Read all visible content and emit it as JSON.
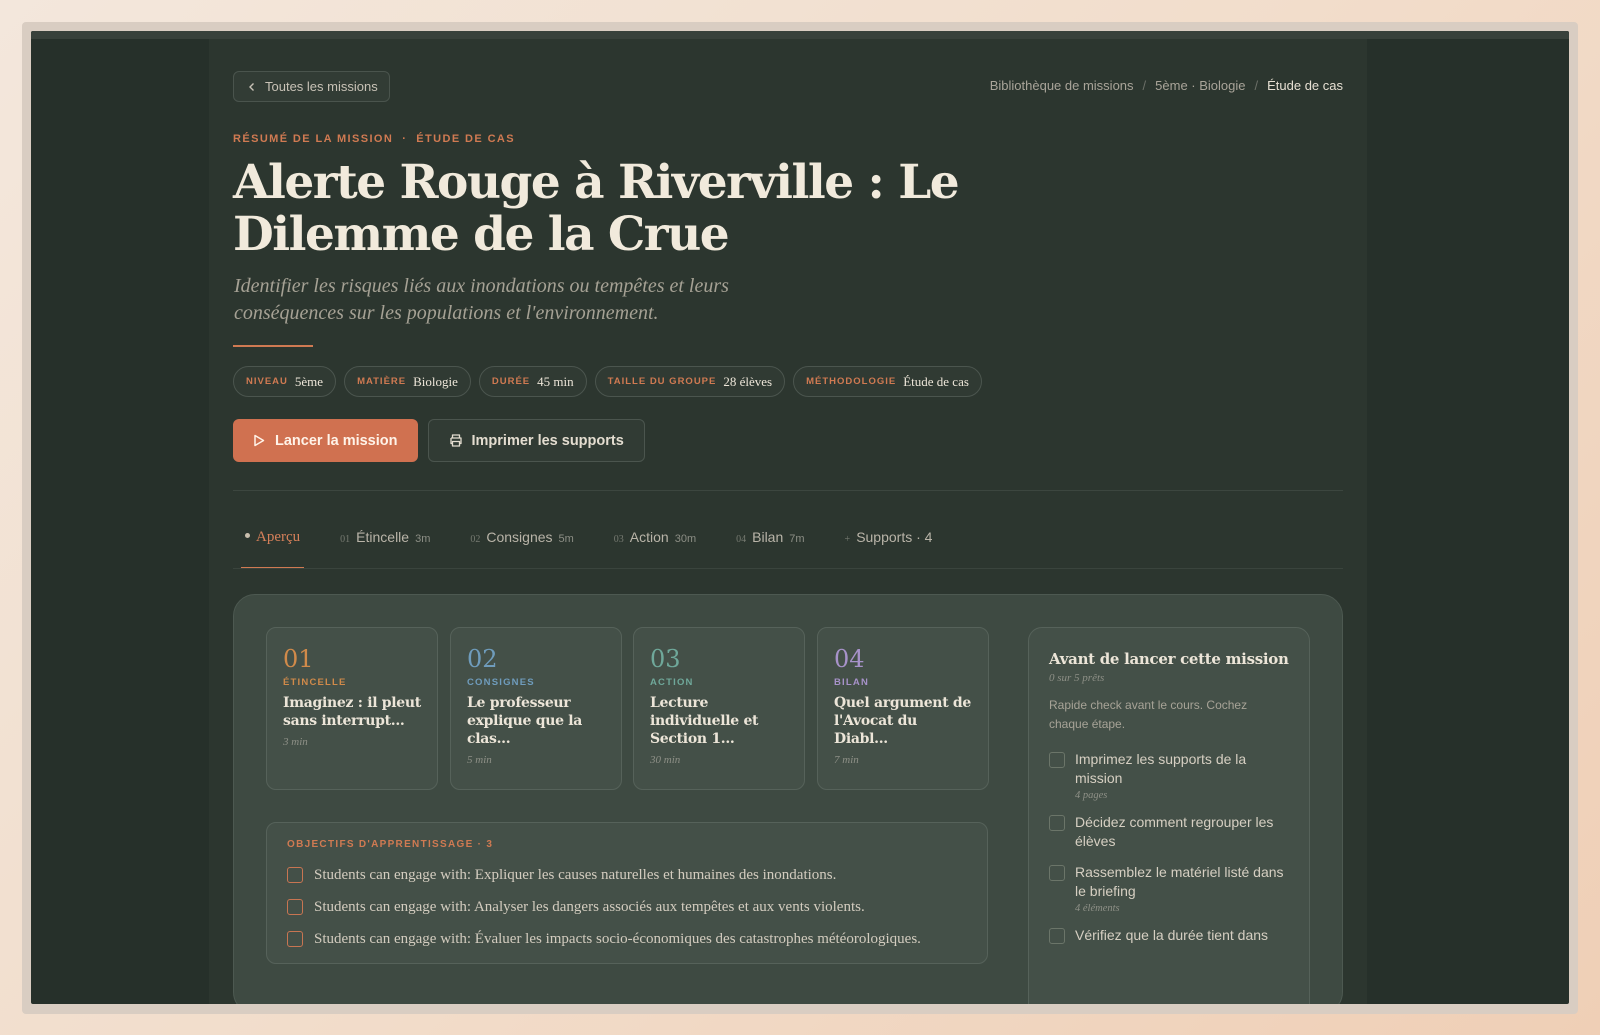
{
  "header": {
    "back_label": "Toutes les missions",
    "breadcrumb": [
      "Bibliothèque de missions",
      "5ème · Biologie",
      "Étude de cas"
    ]
  },
  "mission": {
    "eyebrow": [
      "RÉSUMÉ DE LA MISSION",
      "·",
      "ÉTUDE DE CAS"
    ],
    "title": "Alerte Rouge à Riverville : Le Dilemme de la Crue",
    "subtitle": "Identifier les risques liés aux inondations ou tempêtes et leurs conséquences sur les populations et l'environnement.",
    "meta": [
      {
        "key": "NIVEAU",
        "value": "5ème"
      },
      {
        "key": "MATIÈRE",
        "value": "Biologie"
      },
      {
        "key": "DURÉE",
        "value": "45 min"
      },
      {
        "key": "TAILLE DU GROUPE",
        "value": "28 élèves"
      },
      {
        "key": "MÉTHODOLOGIE",
        "value": "Étude de cas"
      }
    ],
    "launch_label": "Lancer la mission",
    "print_label": "Imprimer les supports"
  },
  "tabs": [
    {
      "num": "",
      "label": "Aperçu",
      "dur": ""
    },
    {
      "num": "01",
      "label": "Étincelle",
      "dur": "3m"
    },
    {
      "num": "02",
      "label": "Consignes",
      "dur": "5m"
    },
    {
      "num": "03",
      "label": "Action",
      "dur": "30m"
    },
    {
      "num": "04",
      "label": "Bilan",
      "dur": "7m"
    },
    {
      "num": "+",
      "label": "Supports · 4",
      "dur": ""
    }
  ],
  "stages": [
    {
      "num": "01",
      "label": "ÉTINCELLE",
      "text": "Imaginez : il pleut sans interrupt...",
      "time": "3 min",
      "color": "#d08a4a"
    },
    {
      "num": "02",
      "label": "CONSIGNES",
      "text": "Le professeur explique que la clas...",
      "time": "5 min",
      "color": "#6f9cbc"
    },
    {
      "num": "03",
      "label": "ACTION",
      "text": "Lecture individuelle et Section 1...",
      "time": "30 min",
      "color": "#6fa89a"
    },
    {
      "num": "04",
      "label": "BILAN",
      "text": "Quel argument de l'Avocat du Diabl...",
      "time": "7 min",
      "color": "#a792c9"
    }
  ],
  "objectives": {
    "title": "OBJECTIFS D'APPRENTISSAGE · 3",
    "items": [
      "Students can engage with: Expliquer les causes naturelles et humaines des inondations.",
      "Students can engage with: Analyser les dangers associés aux tempêtes et aux vents violents.",
      "Students can engage with: Évaluer les impacts socio-économiques des catastrophes météorologiques."
    ]
  },
  "checklist": {
    "title": "Avant de lancer cette mission",
    "progress": "0 sur 5 prêts",
    "description": "Rapide check avant le cours. Cochez chaque étape.",
    "items": [
      {
        "text": "Imprimez les supports de la mission",
        "note": "4 pages"
      },
      {
        "text": "Décidez comment regrouper les élèves",
        "note": ""
      },
      {
        "text": "Rassemblez le matériel listé dans le briefing",
        "note": "4 éléments"
      },
      {
        "text": "Vérifiez que la durée tient dans",
        "note": ""
      }
    ]
  }
}
